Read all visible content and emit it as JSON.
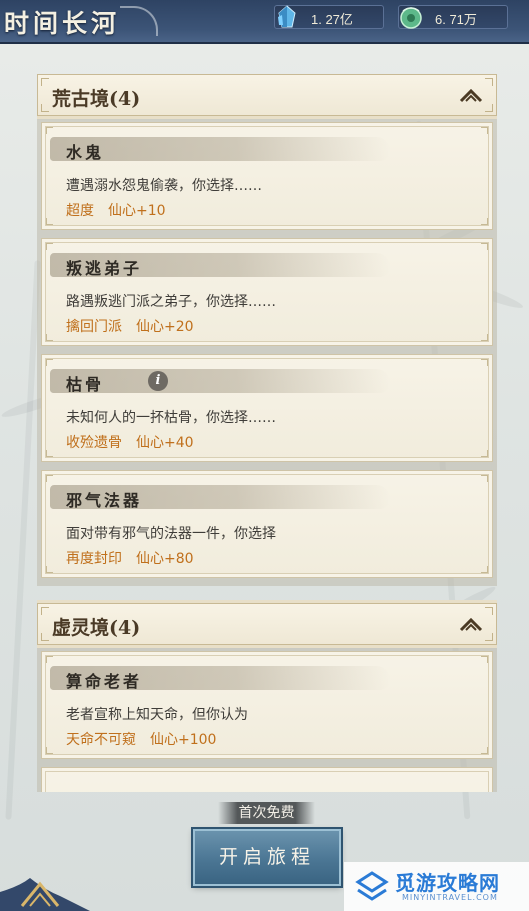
{
  "header": {
    "title": "时间长河",
    "resources": [
      {
        "icon": "blue-crystal-icon",
        "value": "1. 27亿"
      },
      {
        "icon": "jade-coin-icon",
        "value": "6. 71万"
      }
    ]
  },
  "sections": [
    {
      "title": "荒古境(4)",
      "cards": [
        {
          "name": "水鬼",
          "desc": "遭遇溺水怨鬼偷袭，你选择……",
          "reward": "超度　仙心+10"
        },
        {
          "name": "叛逃弟子",
          "desc": "路遇叛逃门派之弟子，你选择……",
          "reward": "擒回门派　仙心+20"
        },
        {
          "name": "枯骨",
          "desc": "未知何人的一抔枯骨，你选择……",
          "reward": "收殓遗骨　仙心+40",
          "info": "i"
        },
        {
          "name": "邪气法器",
          "desc": "面对带有邪气的法器一件，你选择",
          "reward": "再度封印　仙心+80"
        }
      ]
    },
    {
      "title": "虚灵境(4)",
      "cards": [
        {
          "name": "算命老者",
          "desc": "老者宣称上知天命，但你认为",
          "reward": "天命不可窥　仙心+100"
        }
      ]
    }
  ],
  "footer": {
    "free_label": "首次免费",
    "start_button": "开启旅程"
  },
  "watermark": {
    "text": "觅游攻略网",
    "sub": "MINYINTRAVEL.COM"
  },
  "colors": {
    "topbar": "#3c5477",
    "reward_text": "#c0701c",
    "button": "#4b7694"
  }
}
